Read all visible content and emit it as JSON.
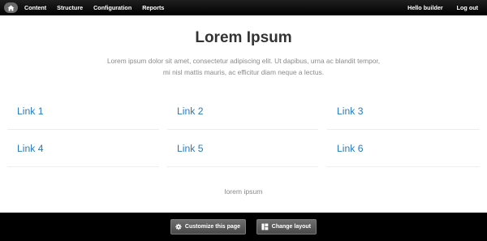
{
  "toolbar": {
    "home_icon": "home-icon",
    "items": [
      "Content",
      "Structure",
      "Configuration",
      "Reports"
    ],
    "user_greeting": "Hello builder",
    "logout": "Log out"
  },
  "main": {
    "title": "Lorem Ipsum",
    "lead_line1": "Lorem ipsum dolor sit amet, consectetur adipiscing elit. Ut dapibus, urna ac blandit tempor,",
    "lead_line2": "mi nisl mattis mauris, ac efficitur diam neque a lectus.",
    "links": [
      "Link 1",
      "Link 2",
      "Link 3",
      "Link 4",
      "Link 5",
      "Link 6"
    ],
    "footer_text": "lorem ipsum"
  },
  "bottom_bar": {
    "customize_label": "Customize this page",
    "customize_icon": "gear-icon",
    "layout_label": "Change layout",
    "layout_icon": "layout-grid-icon"
  },
  "colors": {
    "link": "#2a7ac0",
    "toolbar_bg": "#000000",
    "text_muted": "#8a8a8a"
  }
}
